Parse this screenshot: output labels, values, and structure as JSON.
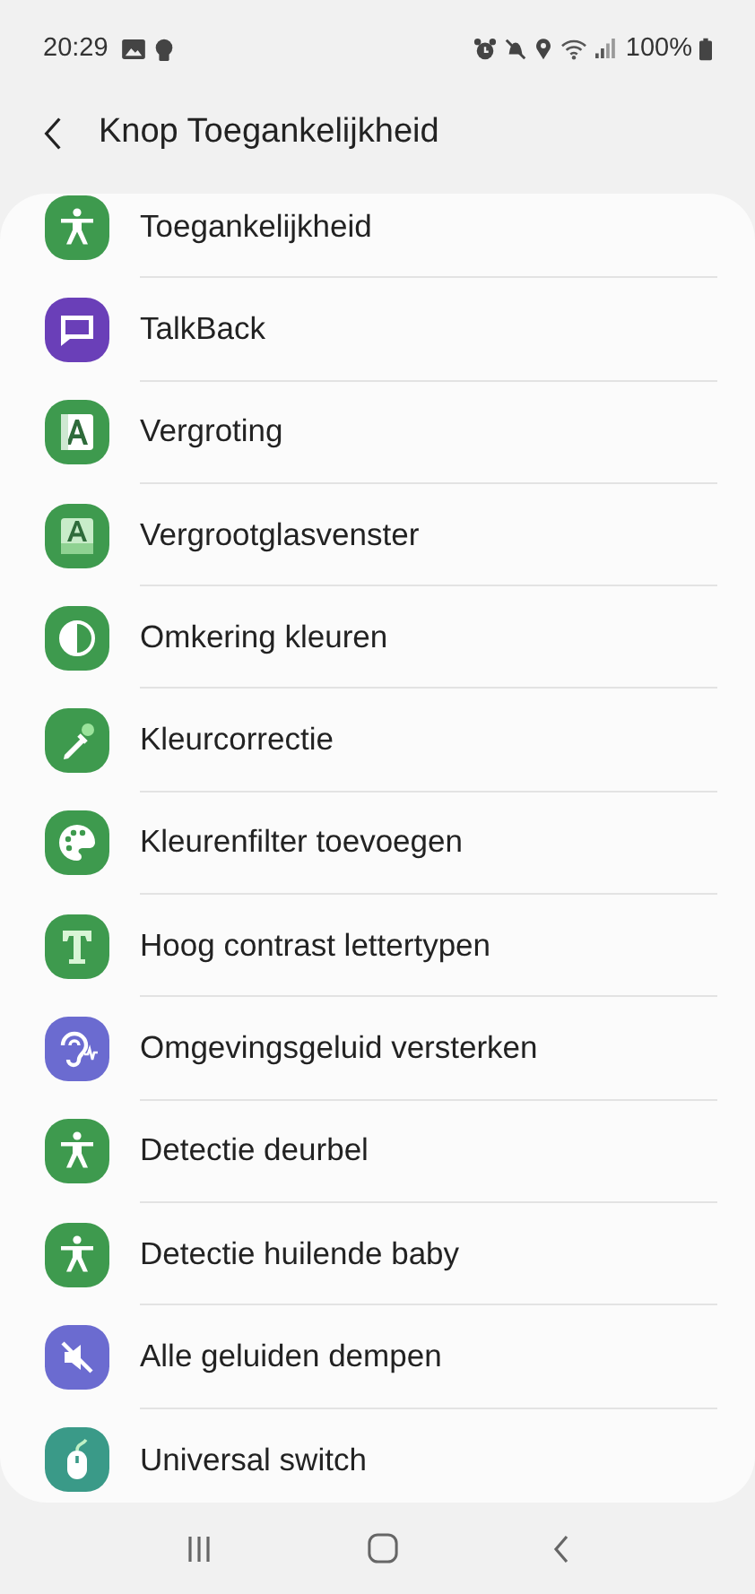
{
  "status_bar": {
    "time": "20:29",
    "battery": "100%"
  },
  "header": {
    "title": "Knop Toegankelijkheid"
  },
  "items": [
    {
      "label": "Toegankelijkheid",
      "kind": "person",
      "color": "#3e9a4e"
    },
    {
      "label": "TalkBack",
      "kind": "bubble",
      "color": "#6a3fb8"
    },
    {
      "label": "Vergroting",
      "kind": "letter_a",
      "color": "#3e9a4e"
    },
    {
      "label": "Vergrootglasvenster",
      "kind": "letter_a_box",
      "color": "#3e9a4e"
    },
    {
      "label": "Omkering kleuren",
      "kind": "half_circle",
      "color": "#3e9a4e"
    },
    {
      "label": "Kleurcorrectie",
      "kind": "dropper",
      "color": "#3e9a4e"
    },
    {
      "label": "Kleurenfilter toevoegen",
      "kind": "palette",
      "color": "#3e9a4e"
    },
    {
      "label": "Hoog contrast lettertypen",
      "kind": "letter_t",
      "color": "#3e9a4e"
    },
    {
      "label": "Omgevingsgeluid versterken",
      "kind": "ear",
      "color": "#6b6bd0"
    },
    {
      "label": "Detectie deurbel",
      "kind": "person",
      "color": "#3e9a4e"
    },
    {
      "label": "Detectie huilende baby",
      "kind": "person",
      "color": "#3e9a4e"
    },
    {
      "label": "Alle geluiden dempen",
      "kind": "mute",
      "color": "#6b6bd0"
    },
    {
      "label": "Universal switch",
      "kind": "mouse",
      "color": "#3a9a88"
    }
  ]
}
